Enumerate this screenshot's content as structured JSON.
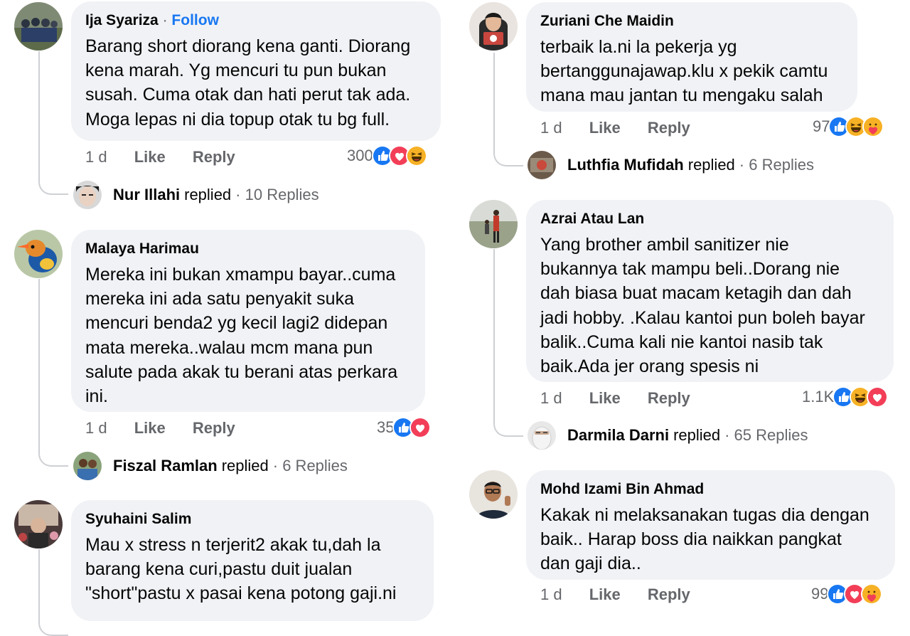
{
  "colors": {
    "bubble": "#f0f2f5",
    "link": "#1877f2",
    "meta": "#65676b",
    "like_blue": "#1877f2",
    "love_red": "#f33e58",
    "haha_yellow": "#f7b125"
  },
  "comments": [
    {
      "author": "Ija Syariza",
      "follow": "Follow",
      "separator": "·",
      "text": "Barang short diorang kena ganti. Diorang\nkena marah. Yg mencuri tu pun bukan\nsusah. Cuma otak dan hati perut tak ada.\nMoga lepas ni dia topup otak tu bg full.",
      "time": "1 d",
      "like": "Like",
      "reply": "Reply",
      "reaction_count": "300",
      "reactions": [
        "like-icon",
        "love-icon",
        "haha-icon"
      ],
      "replied_name": "Nur Illahi",
      "replied_word": "replied",
      "replied_count": "· 10 Replies"
    },
    {
      "author": "Malaya Harimau",
      "text": "Mereka ini bukan xmampu bayar..cuma\nmereka ini ada satu penyakit suka\nmencuri benda2 yg kecil lagi2 didepan\nmata mereka..walau mcm mana pun\nsalute pada akak tu berani atas perkara\nini.",
      "time": "1 d",
      "like": "Like",
      "reply": "Reply",
      "reaction_count": "35",
      "reactions": [
        "like-icon",
        "love-icon"
      ],
      "replied_name": "Fiszal Ramlan",
      "replied_word": "replied",
      "replied_count": "· 6 Replies"
    },
    {
      "author": "Syuhaini Salim",
      "text": "Mau x stress n terjerit2 akak tu,dah la\nbarang kena curi,pastu duit jualan\n\"short\"pastu x pasai kena potong gaji.ni"
    },
    {
      "author": "Zuriani Che Maidin",
      "text": "terbaik la.ni la pekerja yg\nbertanggunajawap.klu x pekik camtu\nmana mau jantan tu mengaku salah",
      "time": "1 d",
      "like": "Like",
      "reply": "Reply",
      "reaction_count": "97",
      "reactions": [
        "like-icon",
        "haha-icon",
        "care-icon"
      ],
      "replied_name": "Luthfia Mufidah",
      "replied_word": "replied",
      "replied_count": "· 6 Replies"
    },
    {
      "author": "Azrai Atau Lan",
      "text": "Yang brother ambil sanitizer nie\nbukannya tak mampu beli..Dorang nie\ndah biasa buat macam ketagih dan dah\njadi hobby. .Kalau kantoi pun boleh bayar\nbalik..Cuma kali nie kantoi nasib tak\nbaik.Ada jer orang spesis ni",
      "time": "1 d",
      "like": "Like",
      "reply": "Reply",
      "reaction_count": "1.1K",
      "reactions": [
        "like-icon",
        "haha-icon",
        "love-icon"
      ],
      "replied_name": "Darmila Darni",
      "replied_word": "replied",
      "replied_count": "· 65 Replies"
    },
    {
      "author": "Mohd Izami Bin Ahmad",
      "text": "Kakak ni melaksanakan tugas dia dengan\nbaik.. Harap boss dia naikkan pangkat\ndan gaji dia..",
      "time": "1 d",
      "like": "Like",
      "reply": "Reply",
      "reaction_count": "99",
      "reactions": [
        "like-icon",
        "love-icon",
        "care-icon"
      ]
    }
  ]
}
